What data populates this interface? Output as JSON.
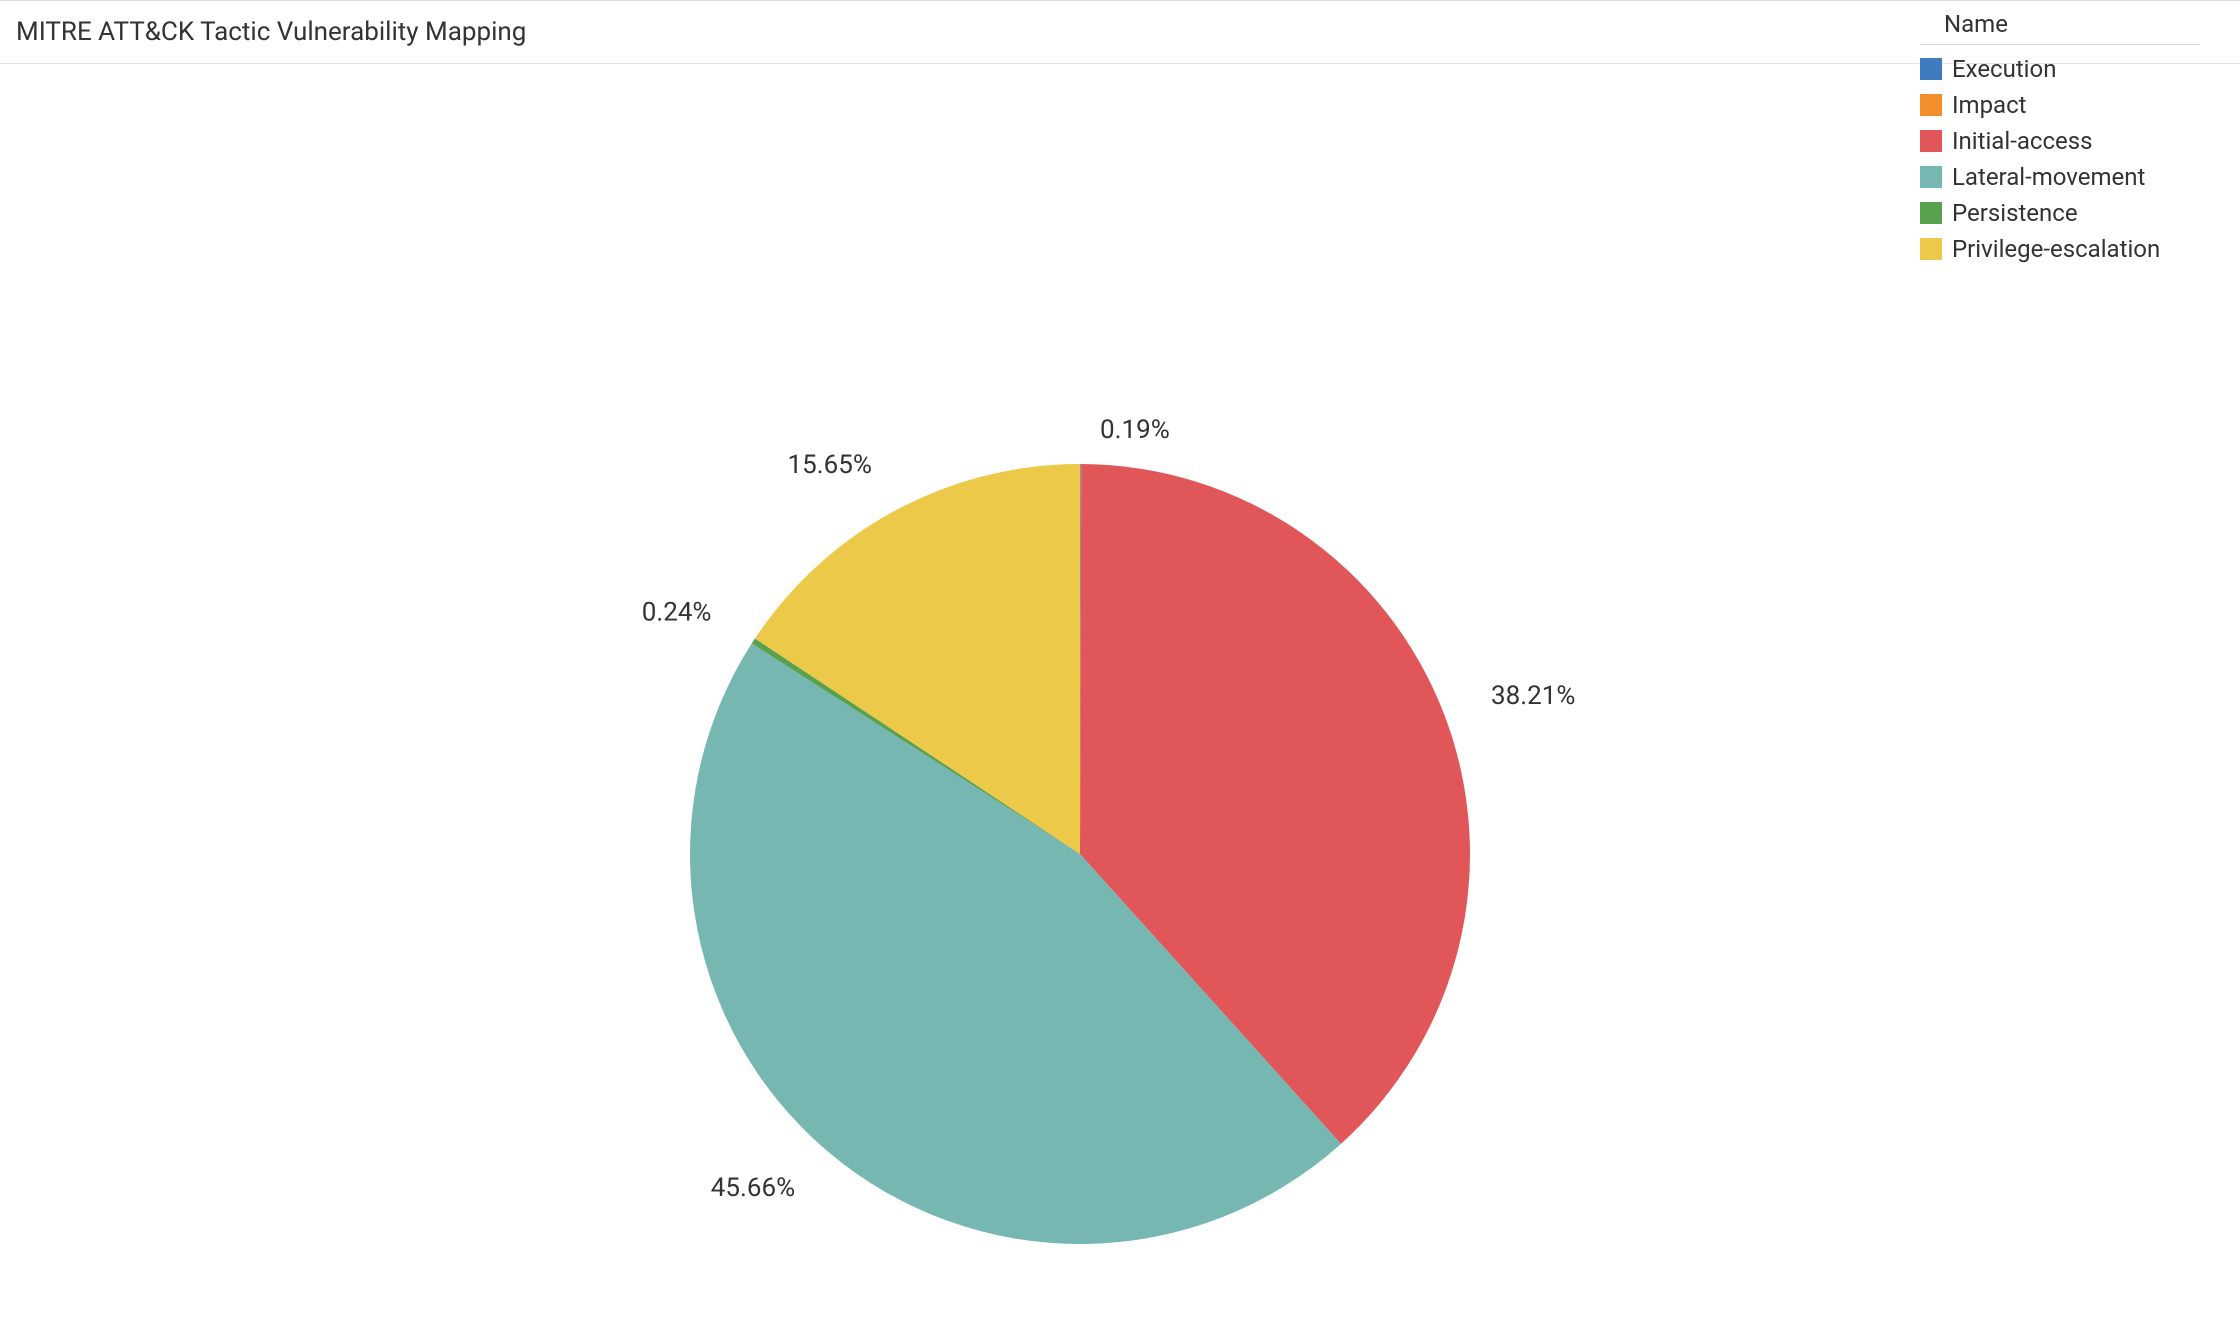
{
  "chart_data": {
    "type": "pie",
    "title": "MITRE ATT&CK Tactic Vulnerability Mapping",
    "legend_title": "Name",
    "series": [
      {
        "name": "Execution",
        "value": 0.03,
        "color": "#3f7cbf",
        "show_label": false
      },
      {
        "name": "Impact",
        "value": 0.02,
        "color": "#f28e2c",
        "show_label": false
      },
      {
        "name": "Initial-access",
        "value": 38.21,
        "color": "#e15759",
        "show_label": true
      },
      {
        "name": "Lateral-movement",
        "value": 45.66,
        "color": "#76b7b2",
        "show_label": true
      },
      {
        "name": "Persistence",
        "value": 0.24,
        "color": "#59a14f",
        "show_label": true
      },
      {
        "name": "Privilege-escalation",
        "value": 15.65,
        "color": "#edc949",
        "show_label": true
      }
    ],
    "rest_label": "0.19%"
  }
}
